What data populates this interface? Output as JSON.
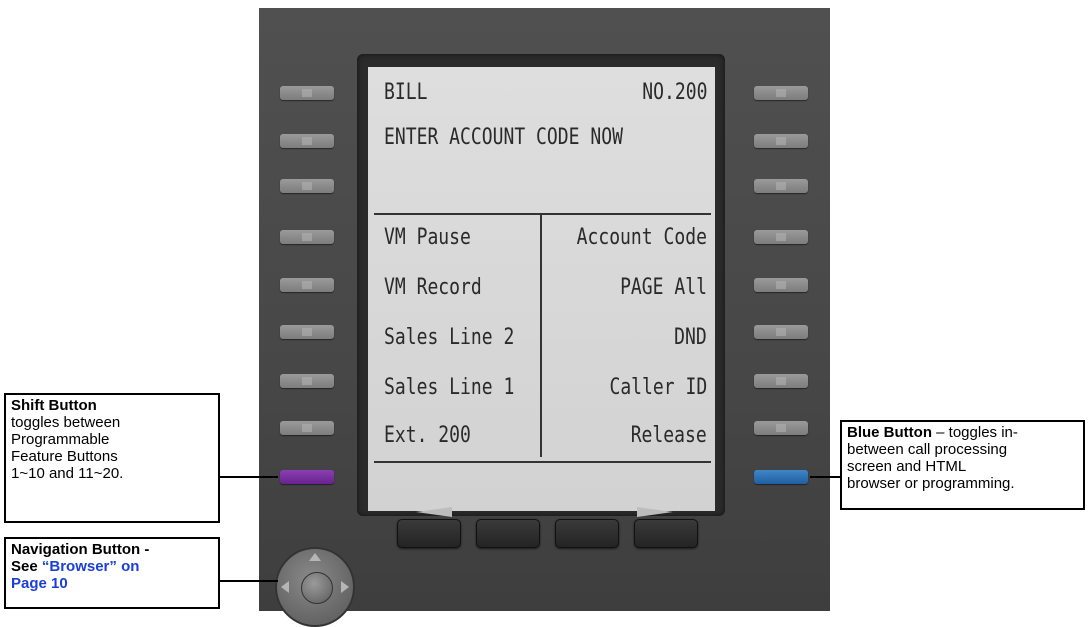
{
  "lcd": {
    "name": "BILL",
    "number": "NO.200",
    "prompt": "ENTER ACCOUNT CODE NOW",
    "left_buttons": [
      "VM Pause",
      "VM Record",
      "Sales Line 2",
      "Sales Line 1",
      "Ext. 200"
    ],
    "right_buttons": [
      "Account Code",
      "PAGE All",
      "DND",
      "Caller ID",
      "Release"
    ]
  },
  "callouts": {
    "shift": {
      "title": "Shift Button",
      "line1": "toggles between",
      "line2": "Programmable",
      "line3": "Feature Buttons",
      "line4": "1~10 and 11~20."
    },
    "navigation": {
      "title": "Navigation Button -",
      "see": "See",
      "link": "“Browser” on",
      "page": "Page 10"
    },
    "blue": {
      "title": "Blue Button",
      "dash": " – toggles in-",
      "line2": "between call processing",
      "line3": "screen and HTML",
      "line4": "browser or programming."
    }
  },
  "colors": {
    "shift_key": "#7a2fa3",
    "blue_key": "#2f74b8",
    "link": "#1a3ed6"
  }
}
